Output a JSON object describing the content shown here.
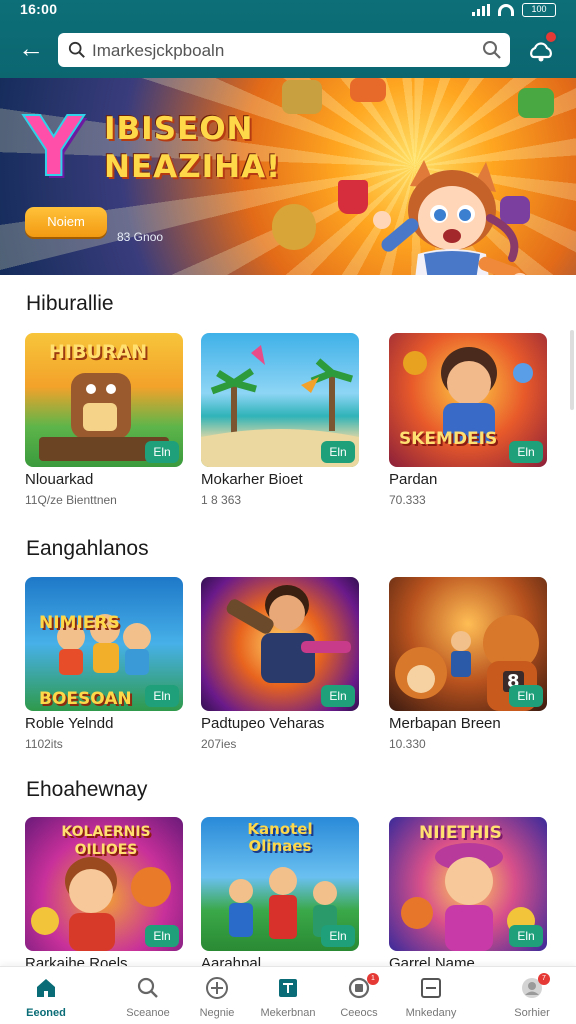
{
  "status": {
    "time": "16:00",
    "battery": "100"
  },
  "search": {
    "placeholder": "Imarkesjckpboaln"
  },
  "hero": {
    "title_line1": "IBISEON",
    "title_line2": "NEAZIHA!",
    "logo_letter": "Y",
    "cta_label": "Noiem",
    "count_text": "83 Gnoo"
  },
  "sections": [
    {
      "title": "Hiburallie",
      "cards": [
        {
          "name": "Nlouarkad",
          "meta": "11Q/ze Bienttnen",
          "tag": "Eln",
          "art_text": "HIBURAN"
        },
        {
          "name": "Mokarher Bioet",
          "meta": "1 8 363",
          "tag": "Eln",
          "art_text": ""
        },
        {
          "name": "Pardan",
          "meta": "70.333",
          "tag": "Eln",
          "art_text": "SKEMDEIS"
        }
      ]
    },
    {
      "title": "Eangahlanos",
      "cards": [
        {
          "name": "Roble Yelndd",
          "meta": "1102its",
          "tag": "Eln",
          "art_text": "NIMIERS BOESOAN"
        },
        {
          "name": "Padtupeo Veharas",
          "meta": "207ies",
          "tag": "Eln",
          "art_text": ""
        },
        {
          "name": "Merbapan Breen",
          "meta": "10.330",
          "tag": "Eln",
          "art_text": "8"
        }
      ]
    },
    {
      "title": "Ehoahewnay",
      "cards": [
        {
          "name": "Rarkaihe Roels",
          "meta": "",
          "tag": "Eln",
          "art_text": "KOLAERNIS OILIOES"
        },
        {
          "name": "Aarahpal",
          "meta": "",
          "tag": "Eln",
          "art_text": "Kanotel Olinaes"
        },
        {
          "name": "Garrel Name",
          "meta": "",
          "tag": "Eln",
          "art_text": "NIIETHIS"
        }
      ]
    }
  ],
  "nav": [
    {
      "label": "Eeoned",
      "icon": "home-icon",
      "active": true
    },
    {
      "label": "Sceanoe",
      "icon": "search-icon",
      "active": false
    },
    {
      "label": "Negnie",
      "icon": "add-circle-icon",
      "active": false
    },
    {
      "label": "Mekerbnan",
      "icon": "library-icon",
      "active": false
    },
    {
      "label": "Ceeocs",
      "icon": "chat-icon",
      "active": false,
      "badge": "1"
    },
    {
      "label": "Mnkedany",
      "icon": "inbox-icon",
      "active": false
    },
    {
      "label": "Sorhier",
      "icon": "profile-icon",
      "active": false,
      "badge": "7"
    }
  ],
  "colors": {
    "brand": "#0b6670",
    "accent": "#f5a623",
    "tag": "#1f9f7a",
    "badge": "#e53935"
  }
}
